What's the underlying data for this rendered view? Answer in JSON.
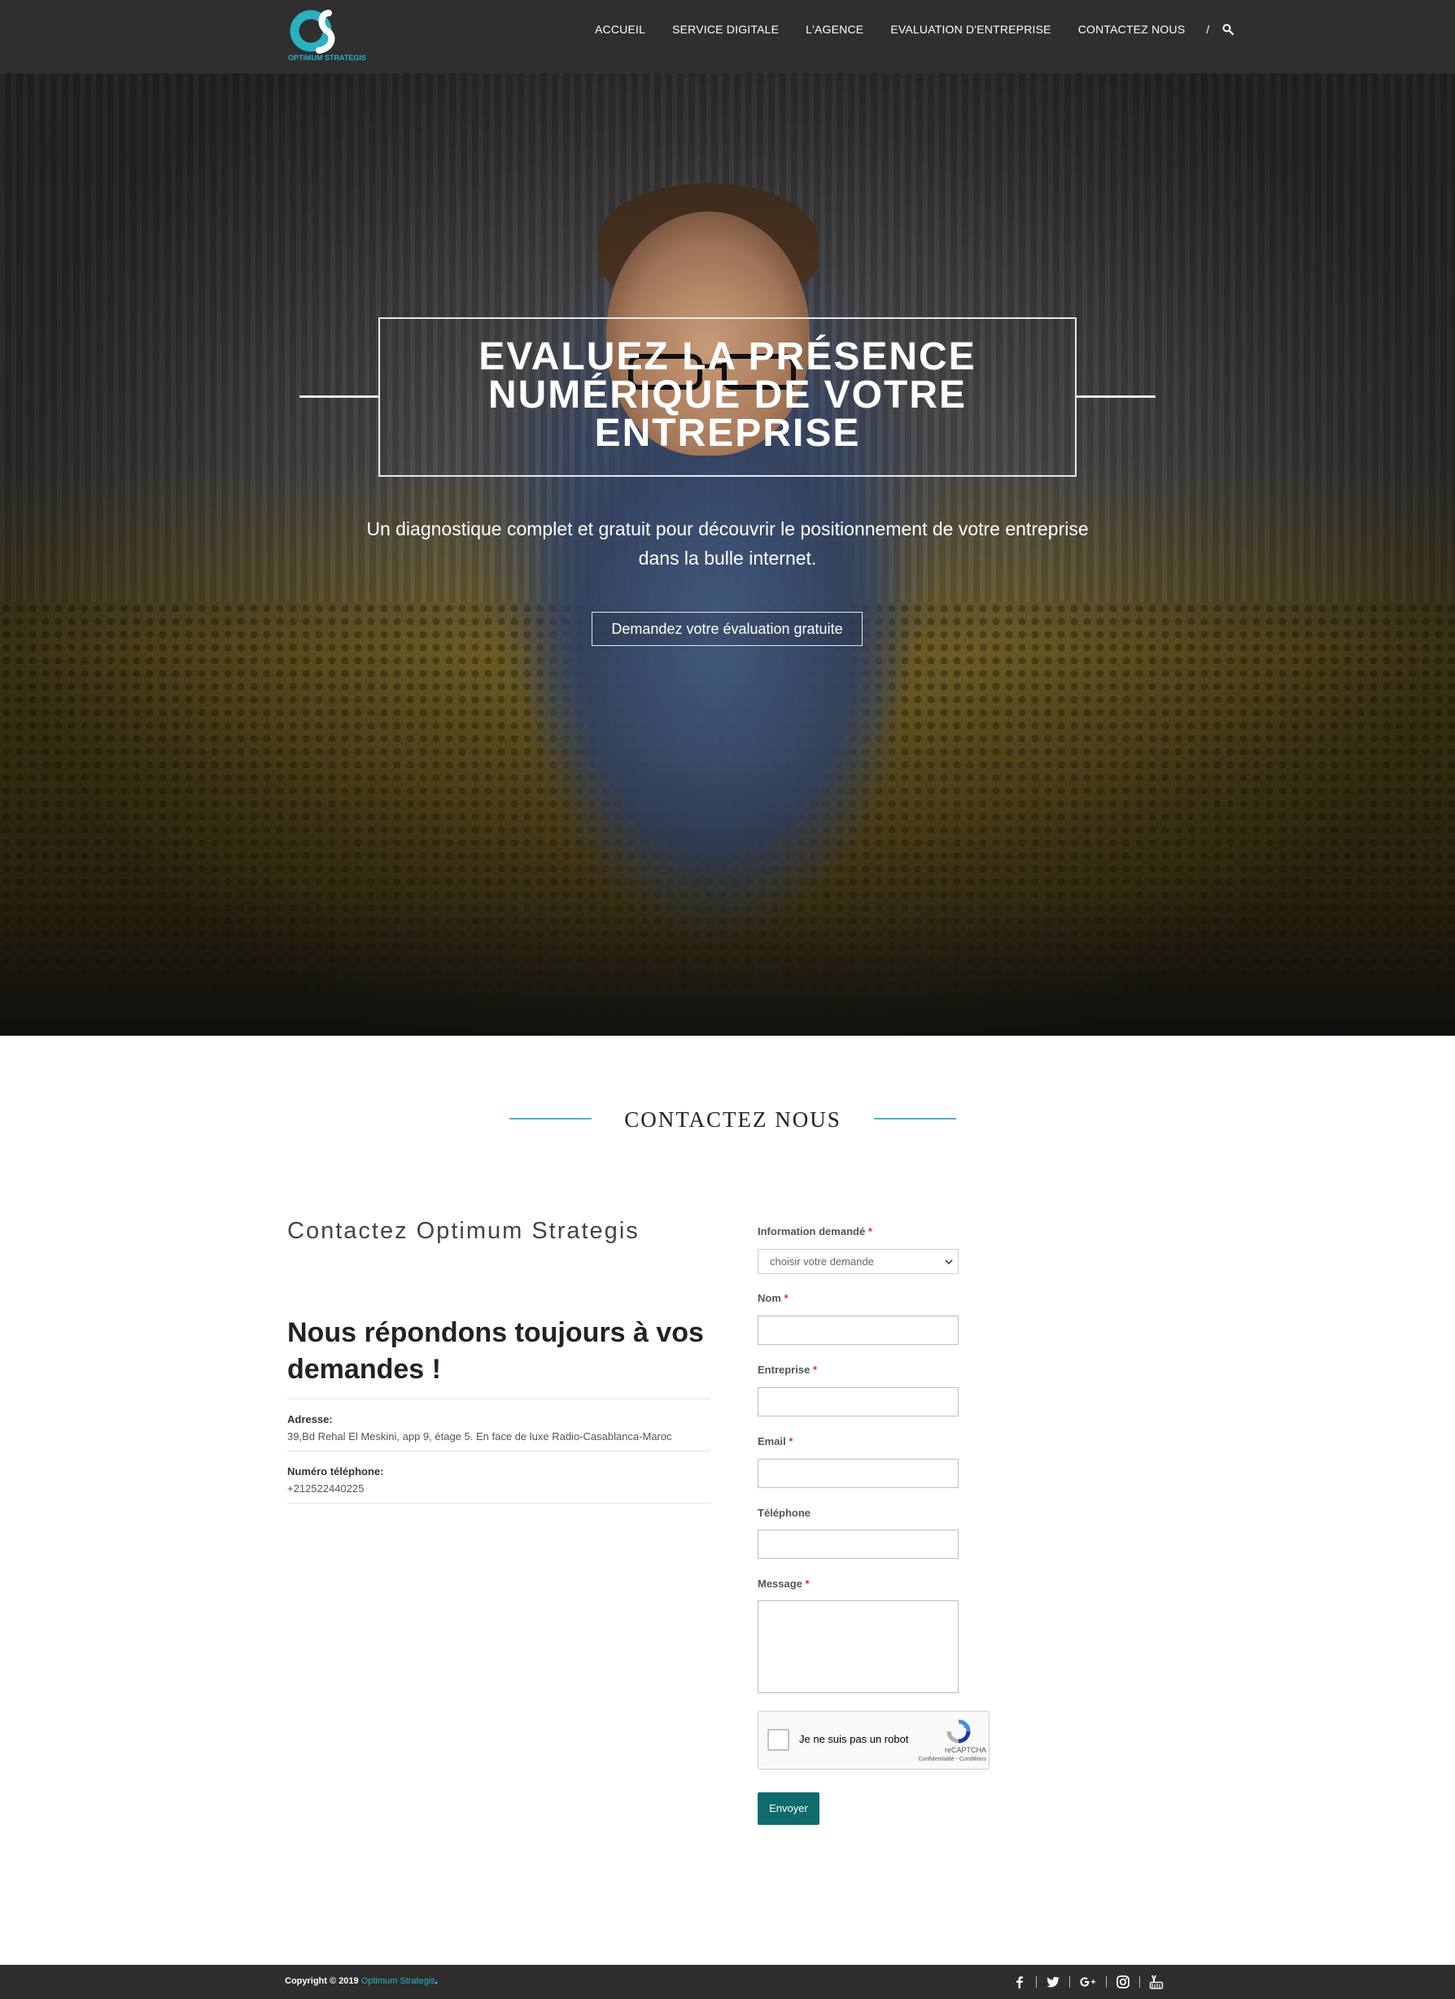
{
  "header": {
    "logo_text": "OPTIMUM STRATEGIS",
    "nav": [
      "ACCUEIL",
      "SERVICE DIGITALE",
      "L'AGENCE",
      "EVALUATION D'ENTREPRISE",
      "CONTACTEZ NOUS"
    ],
    "nav_separator": "/"
  },
  "hero": {
    "title_line1": "EVALUEZ LA PRÉSENCE",
    "title_line2": "NUMÉRIQUE DE VOTRE",
    "title_line3": "ENTREPRISE",
    "subtitle_line1": "Un diagnostique complet et gratuit pour découvrir le positionnement de votre entreprise",
    "subtitle_line2": "dans la bulle internet.",
    "button_label": "Demandez votre évaluation gratuite"
  },
  "contact": {
    "section_title": "CONTACTEZ NOUS",
    "heading": "Contactez Optimum Strategis",
    "respond_title": "Nous répondons toujours à vos demandes !",
    "address_label": "Adresse:",
    "address_value": "39,Bd Rehal El Meskini, app 9, étage 5. En face de luxe Radio-Casablanca-Maroc",
    "phone_label": "Numéro téléphone:",
    "phone_value": "+212522440225"
  },
  "form": {
    "info_label": "Information demandé",
    "info_selected": "choisir votre demande",
    "nom_label": "Nom",
    "entreprise_label": "Entreprise",
    "email_label": "Email",
    "telephone_label": "Téléphone",
    "message_label": "Message",
    "required_mark": "*",
    "captcha_text": "Je ne suis pas un robot",
    "captcha_brand": "reCAPTCHA",
    "captcha_terms": "Confidentialité - Conditions",
    "submit_label": "Envoyer"
  },
  "footer": {
    "copyright_prefix": "Copyright © 2019",
    "copyright_brand": "Optimum Strategis",
    "copyright_suffix": ".",
    "social": [
      "facebook-icon",
      "twitter-icon",
      "google-plus-icon",
      "instagram-icon",
      "youtube-icon"
    ]
  },
  "colors": {
    "header_bg": "#2f2f2f",
    "accent": "#2bb0c0",
    "section_line": "#4fb3c2",
    "submit_bg": "#0f6b6b",
    "footer_bg": "#2e2e2e",
    "required": "#dd3333"
  }
}
